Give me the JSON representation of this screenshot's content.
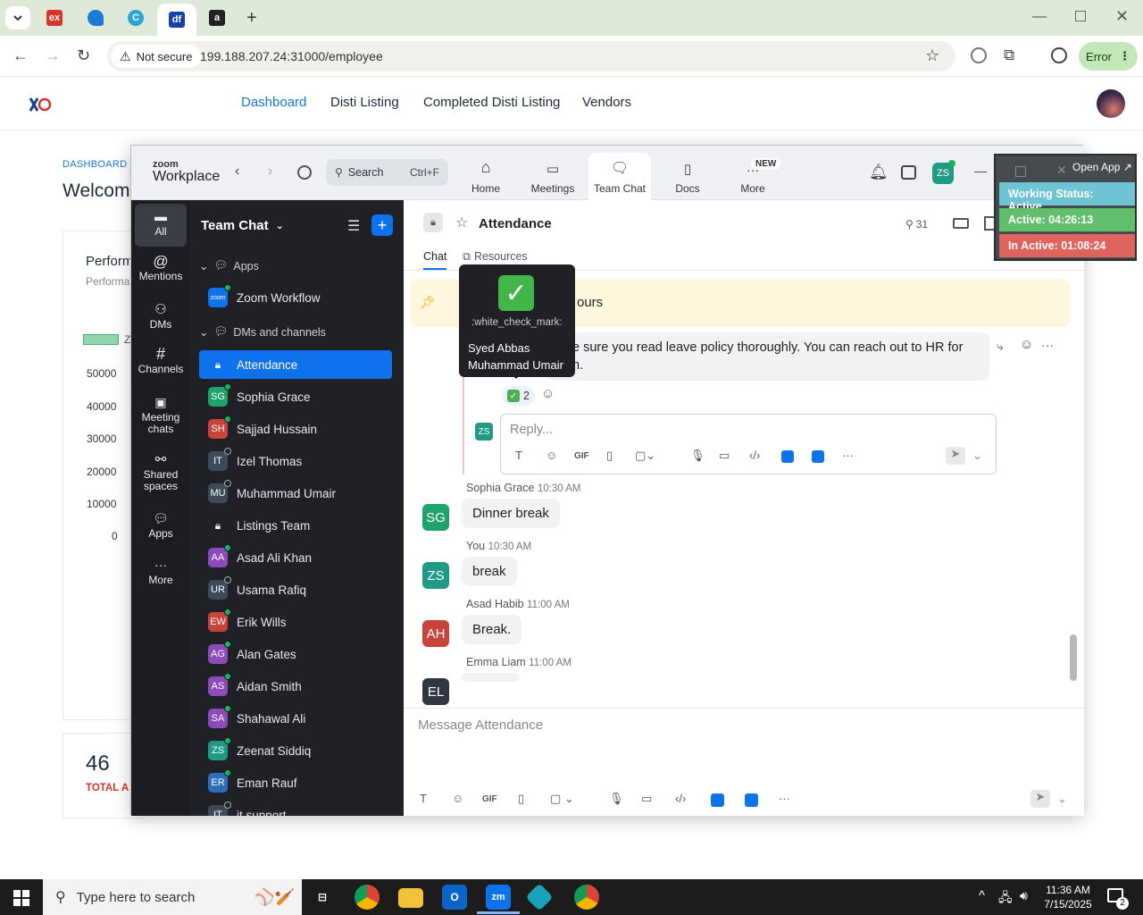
{
  "browser": {
    "tabs": [
      {
        "icon": "ex-favicon",
        "label": "ex",
        "color": "#d9342b"
      },
      {
        "icon": "blue-app-favicon",
        "label": "",
        "color": "#1b7bd9"
      },
      {
        "icon": "c-favicon",
        "label": "C",
        "color": "#2aa4d6"
      },
      {
        "icon": "df-favicon",
        "label": "df",
        "color": "#1740a8"
      },
      {
        "icon": "amazon-favicon",
        "label": "a",
        "color": "#222222"
      }
    ],
    "not_secure_label": "Not secure",
    "url": "199.188.207.24:31000/employee",
    "error_label": "Error"
  },
  "site": {
    "nav": [
      "Dashboard",
      "Disti Listing",
      "Completed Disti Listing",
      "Vendors"
    ],
    "breadcrumb": "DASHBOARD",
    "welcome": "Welcom",
    "card_title": "Perform",
    "card_subtitle": "Performa",
    "legend_label": "Z",
    "y_ticks": [
      "50000",
      "40000",
      "30000",
      "20000",
      "10000",
      "0"
    ],
    "stat_value": "46",
    "stat_label": "TOTAL A"
  },
  "zoom": {
    "logo_small": "zoom",
    "logo_big": "Workplace",
    "search_label": "Search",
    "search_shortcut": "Ctrl+F",
    "top_tabs": [
      "Home",
      "Meetings",
      "Team Chat",
      "Docs",
      "More"
    ],
    "new_badge": "NEW",
    "user_initials": "ZS",
    "rail": [
      "All",
      "Mentions",
      "DMs",
      "Channels",
      "Meeting chats",
      "Shared spaces",
      "Apps",
      "More"
    ],
    "list_title": "Team Chat",
    "section_apps": "Apps",
    "app_item": "Zoom Workflow",
    "app_item_icon": "zoom",
    "section_dms": "DMs and channels",
    "items": [
      {
        "name": "Attendance",
        "initials": "",
        "color": "#0e72ed",
        "status": "none"
      },
      {
        "name": "Sophia Grace",
        "initials": "SG",
        "color": "#20a36a",
        "status": "on"
      },
      {
        "name": "Sajjad Hussain",
        "initials": "SH",
        "color": "#c8443a",
        "status": "on"
      },
      {
        "name": "Izel Thomas",
        "initials": "IT",
        "color": "#3d4a5a",
        "status": "off"
      },
      {
        "name": "Muhammad Umair",
        "initials": "MU",
        "color": "#3d4a5a",
        "status": "off"
      },
      {
        "name": "Listings Team",
        "initials": "",
        "color": "#3a3d43",
        "status": "none"
      },
      {
        "name": "Asad Ali Khan",
        "initials": "AA",
        "color": "#8d4bb8",
        "status": "on"
      },
      {
        "name": "Usama Rafiq",
        "initials": "UR",
        "color": "#3d4a5a",
        "status": "off"
      },
      {
        "name": "Erik Wills",
        "initials": "EW",
        "color": "#c8443a",
        "status": "on"
      },
      {
        "name": "Alan Gates",
        "initials": "AG",
        "color": "#8d4bb8",
        "status": "on"
      },
      {
        "name": "Aidan Smith",
        "initials": "AS",
        "color": "#8d4bb8",
        "status": "on"
      },
      {
        "name": "Shahawal Ali",
        "initials": "SA",
        "color": "#8d4bb8",
        "status": "on"
      },
      {
        "name": "Zeenat Siddiq",
        "initials": "ZS",
        "color": "#1f9a84",
        "status": "on"
      },
      {
        "name": "Eman Rauf",
        "initials": "ER",
        "color": "#2a6fb8",
        "status": "on"
      },
      {
        "name": "it support",
        "initials": "IT",
        "color": "#3d4a5a",
        "status": "off"
      }
    ],
    "channel_title": "Attendance",
    "member_count": "31",
    "chat_tab": "Chat",
    "resources_tab": "Resources",
    "pinned_text": "ours",
    "thread_text_1": "e sure you read leave policy thoroughly. You can reach out to HR for",
    "thread_text_2": "n.",
    "reaction_count": "2",
    "reply_placeholder": "Reply...",
    "reply_avatar": "ZS",
    "gif_label": "GIF",
    "tooltip": {
      "emoji_name": ":white_check_mark:",
      "user1": "Syed Abbas",
      "user2": "Muhammad Umair"
    },
    "messages": [
      {
        "name": "Sophia Grace",
        "time": "10:30 AM",
        "text": "Dinner break",
        "initials": "SG",
        "color": "#20a36a"
      },
      {
        "name": "You",
        "time": "10:30 AM",
        "text": "break",
        "initials": "ZS",
        "color": "#1f9a84"
      },
      {
        "name": "Asad Habib",
        "time": "11:00 AM",
        "text": "Break.",
        "initials": "AH",
        "color": "#c8443a"
      },
      {
        "name": "Emma Liam",
        "time": "11:00 AM",
        "text": "",
        "initials": "EL",
        "color": "#2f3640"
      }
    ],
    "compose_placeholder": "Message Attendance"
  },
  "status_panel": {
    "open_app": "Open App",
    "working": "Working Status: Active",
    "active": "Active: 04:26:13",
    "inactive": "In Active: 01:08:24",
    "colors": {
      "working": "#6ec3d4",
      "active": "#5fbf6a",
      "inactive": "#e0645e"
    }
  },
  "taskbar": {
    "search_placeholder": "Type here to search",
    "time": "11:36 AM",
    "date": "7/15/2025",
    "notification_count": "2"
  }
}
